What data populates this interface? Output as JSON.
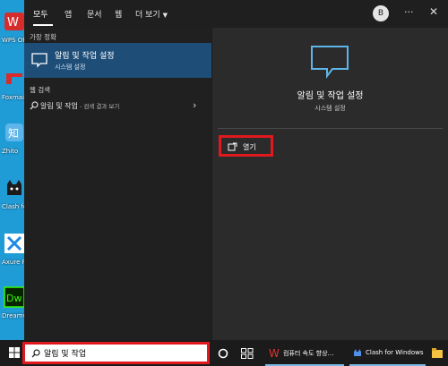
{
  "desktop_icons": [
    {
      "label": "WPS Office",
      "icon": "wps-office-icon",
      "color": "#d62c2c"
    },
    {
      "label": "Foxmail",
      "icon": "foxmail-icon",
      "color": "#d62c2c"
    },
    {
      "label": "Zhito",
      "icon": "zhito-icon",
      "color": "#2a7fd4"
    },
    {
      "label": "Clash for Windows",
      "icon": "clash-cat-icon",
      "color": "#1b1b1b"
    },
    {
      "label": "Axure RP",
      "icon": "axure-icon",
      "color": "#1e88e5"
    },
    {
      "label": "Dreamweaver",
      "icon": "dreamweaver-icon",
      "color": "#35fa00"
    }
  ],
  "header": {
    "tabs": [
      "모두",
      "앱",
      "문서",
      "웹",
      "더 보기"
    ],
    "avatar_letter": "B",
    "more_glyph": "···",
    "close_glyph": "✕"
  },
  "left": {
    "best_match_title": "가장 정확",
    "best_match": {
      "title": "알림 및 작업 설정",
      "subtitle": "시스템 설정"
    },
    "web_search_title": "웹 검색",
    "web_result": {
      "query": "알림 및 작업",
      "suffix": " - 검색 결과 보기"
    }
  },
  "right": {
    "title": "알림 및 작업 설정",
    "subtitle": "시스템 설정",
    "open_label": "열기"
  },
  "taskbar": {
    "search_value": "알림 및 작업",
    "items": [
      {
        "label": "컴퓨터 속도 향상…",
        "icon": "wps-icon"
      },
      {
        "label": "Clash for Windows",
        "icon": "clash-icon"
      }
    ]
  },
  "colors": {
    "accent": "#1e4e78",
    "highlight": "#e0191f"
  }
}
